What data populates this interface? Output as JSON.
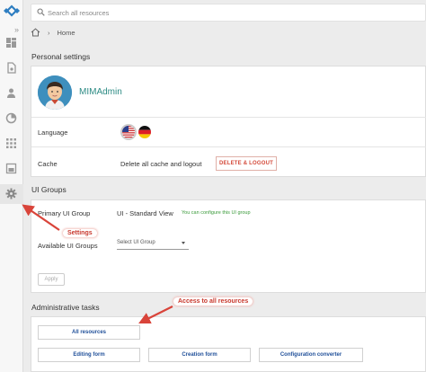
{
  "sidebar": {
    "items": [
      {
        "icon": "dashboard-icon"
      },
      {
        "icon": "document-icon"
      },
      {
        "icon": "person-icon"
      },
      {
        "icon": "chart-icon"
      },
      {
        "icon": "grid-icon"
      },
      {
        "icon": "report-icon"
      },
      {
        "icon": "gear-icon",
        "active": true
      }
    ]
  },
  "search": {
    "placeholder": "Search all resources"
  },
  "breadcrumb": {
    "home": "Home"
  },
  "personal": {
    "title": "Personal settings",
    "username": "MIMAdmin",
    "language_label": "Language",
    "cache_label": "Cache",
    "cache_text": "Delete all cache and logout",
    "cache_button": "DELETE & LOGOUT"
  },
  "ui_groups": {
    "title": "UI Groups",
    "primary_label": "Primary UI Group",
    "primary_value": "UI - Standard View",
    "primary_hint": "You can configure this UI group",
    "available_label": "Available UI Groups",
    "select_placeholder": "Select UI Group",
    "apply_button": "Apply"
  },
  "admin": {
    "title": "Administrative tasks",
    "buttons": [
      "All resources",
      "Editing form",
      "Creation form",
      "Configuration converter"
    ]
  },
  "annotations": {
    "settings": "Settings",
    "resources": "Access to all resources",
    "color": "#d9443a"
  }
}
